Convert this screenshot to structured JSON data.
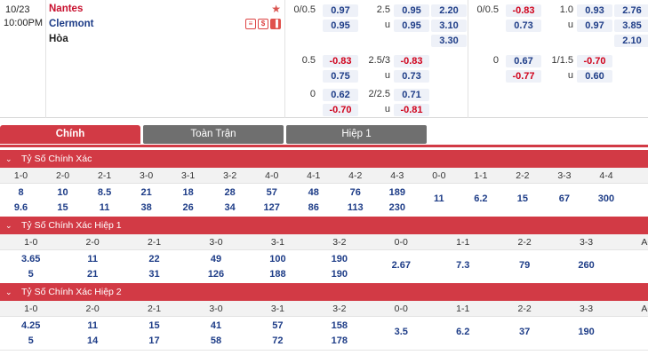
{
  "match": {
    "date": "10/23",
    "time": "10:00PM",
    "home": "Nantes",
    "away": "Clermont",
    "draw": "Hòa",
    "tags": [
      "≡",
      "$",
      "▐"
    ]
  },
  "odds_block_1": [
    {
      "line": "0/0.5",
      "a": "0.97",
      "b": "0.95",
      "a_red": false,
      "b_red": false,
      "ou": "2.5",
      "ou_a": "0.95",
      "ou_u": "u",
      "ou_b": "0.95",
      "ou_a_red": false,
      "ou_b_red": false,
      "x": [
        "2.20",
        "3.10",
        "3.30"
      ]
    },
    {
      "line": "0.5",
      "a": "-0.83",
      "b": "0.75",
      "a_red": true,
      "b_red": false,
      "ou": "2.5/3",
      "ou_a": "-0.83",
      "ou_u": "u",
      "ou_b": "0.73",
      "ou_a_red": true,
      "ou_b_red": false
    },
    {
      "line": "0",
      "a": "0.62",
      "b": "-0.70",
      "a_red": false,
      "b_red": true,
      "ou": "2/2.5",
      "ou_a": "0.71",
      "ou_u": "u",
      "ou_b": "-0.81",
      "ou_a_red": false,
      "ou_b_red": true
    }
  ],
  "odds_block_2": [
    {
      "line": "0/0.5",
      "a": "-0.83",
      "b": "0.73",
      "a_red": true,
      "b_red": false,
      "ou": "1.0",
      "ou_a": "0.93",
      "ou_u": "u",
      "ou_b": "0.97",
      "ou_a_red": false,
      "ou_b_red": false,
      "x": [
        "2.76",
        "3.85",
        "2.10"
      ]
    },
    {
      "line": "0",
      "a": "0.67",
      "b": "-0.77",
      "a_red": false,
      "b_red": true,
      "ou": "1/1.5",
      "ou_a": "-0.70",
      "ou_u": "u",
      "ou_b": "0.60",
      "ou_a_red": true,
      "ou_b_red": false
    }
  ],
  "tabs": [
    "Chính",
    "Toàn Trận",
    "Hiệp 1"
  ],
  "sections": [
    {
      "title": "Tỷ Số Chính Xác",
      "headers": [
        "1-0",
        "2-0",
        "2-1",
        "3-0",
        "3-1",
        "3-2",
        "4-0",
        "4-1",
        "4-2",
        "4-3",
        "0-0",
        "1-1",
        "2-2",
        "3-3",
        "4-4"
      ],
      "row1": [
        "8",
        "10",
        "8.5",
        "21",
        "18",
        "28",
        "57",
        "48",
        "76",
        "189",
        "11",
        "6.2",
        "15",
        "67",
        "300"
      ],
      "row2": [
        "9.6",
        "15",
        "11",
        "38",
        "26",
        "34",
        "127",
        "86",
        "113",
        "230"
      ]
    },
    {
      "title": "Tỷ Số Chính Xác Hiệp 1",
      "headers": [
        "1-0",
        "2-0",
        "2-1",
        "3-0",
        "3-1",
        "3-2",
        "0-0",
        "1-1",
        "2-2",
        "3-3",
        "AO"
      ],
      "row1": [
        "3.65",
        "11",
        "22",
        "49",
        "100",
        "190",
        "2.67",
        "7.3",
        "79",
        "260"
      ],
      "row2": [
        "5",
        "21",
        "31",
        "126",
        "188",
        "190"
      ]
    },
    {
      "title": "Tỷ Số Chính Xác Hiệp 2",
      "headers": [
        "1-0",
        "2-0",
        "2-1",
        "3-0",
        "3-1",
        "3-2",
        "0-0",
        "1-1",
        "2-2",
        "3-3",
        "AO"
      ],
      "row1": [
        "4.25",
        "11",
        "15",
        "41",
        "57",
        "158",
        "3.5",
        "6.2",
        "37",
        "190"
      ],
      "row2": [
        "5",
        "14",
        "17",
        "58",
        "72",
        "178"
      ]
    }
  ]
}
